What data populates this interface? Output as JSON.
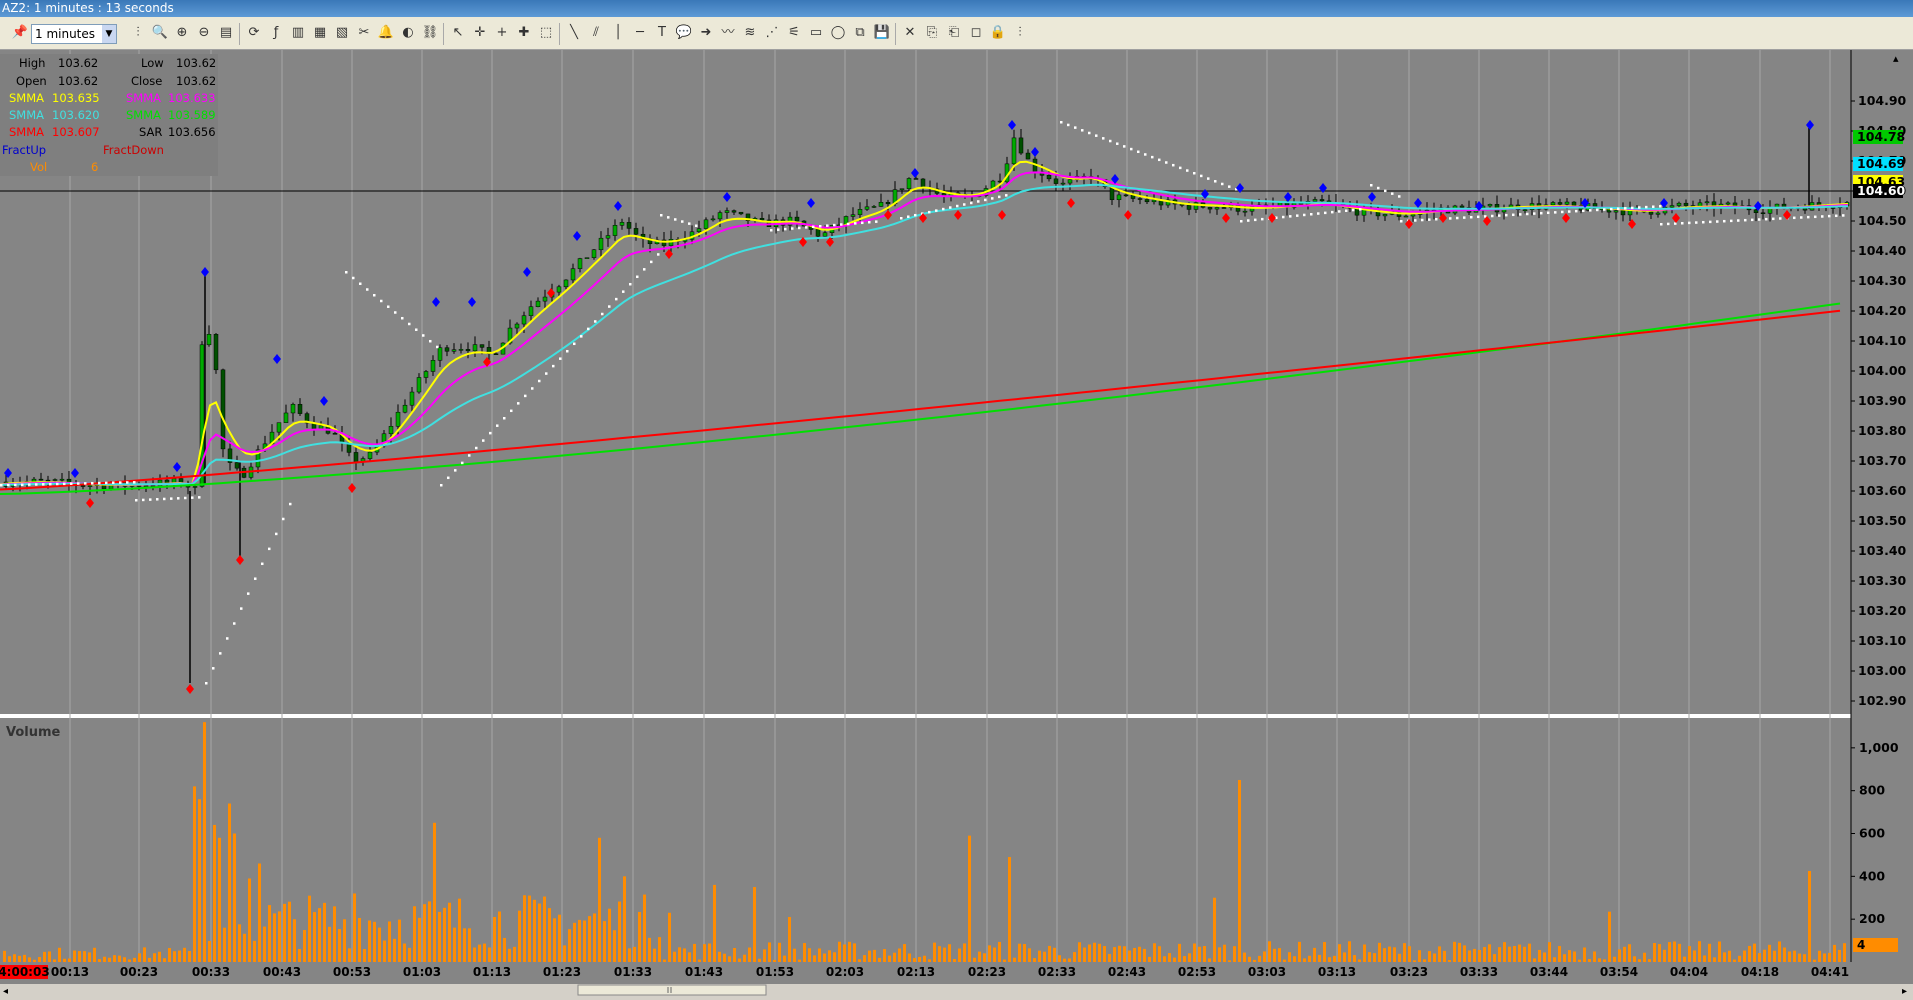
{
  "window": {
    "title": "AZ2: 1 minutes : 13 seconds"
  },
  "toolbar": {
    "interval": "1 minutes",
    "icons": [
      "pin-icon",
      "bar-style-icon",
      "zoom-icon",
      "zoom-in-icon",
      "zoom-out-icon",
      "properties-icon",
      "refresh-icon",
      "indicator-icon",
      "bars-icon",
      "colors-icon",
      "template-icon",
      "scissors-icon",
      "alert-icon",
      "globe-icon",
      "link-icon",
      "pointer-icon",
      "crosshair-icon",
      "cross-icon",
      "marker-icon",
      "select-icon",
      "line-icon",
      "parallel-icon",
      "vertical-line-icon",
      "horizontal-line-icon",
      "text-icon",
      "callout-icon",
      "arrow-icon",
      "wave-icon",
      "fib-icon",
      "pitchfork-icon",
      "gann-icon",
      "channel-icon",
      "rectangle-icon",
      "ellipse-icon",
      "layer-icon",
      "save-icon",
      "delete-icon",
      "copy-icon",
      "paste-icon",
      "frame-icon",
      "lock-icon"
    ]
  },
  "info": {
    "high_label": "High",
    "high": "103.62",
    "low_label": "Low",
    "low": "103.62",
    "open_label": "Open",
    "open": "103.62",
    "close_label": "Close",
    "close": "103.62",
    "smma_label": "SMMA",
    "sar_label": "SAR",
    "smma_yellow": "103.635",
    "smma_magenta": "103.633",
    "smma_cyan": "103.620",
    "smma_green": "103.589",
    "smma_red": "103.607",
    "sar": "103.656",
    "fract_up": "FractUp",
    "fract_down": "FractDown",
    "vol_label": "Vol",
    "vol": "6"
  },
  "chart_data": {
    "type": "candlestick",
    "price_axis": [
      "104.90",
      "104.80",
      "104.70",
      "104.60",
      "104.50",
      "104.40",
      "104.30",
      "104.20",
      "104.10",
      "104.00",
      "103.90",
      "103.80",
      "103.70",
      "103.60",
      "103.50",
      "103.40",
      "103.30",
      "103.20",
      "103.10",
      "103.00",
      "102.90"
    ],
    "price_range": [
      102.85,
      105.07
    ],
    "price_badges": [
      {
        "value": "104.78",
        "color": "#00c800",
        "text_color": "#000000"
      },
      {
        "value": "104.69",
        "color": "#00e0ff",
        "text_color": "#000000"
      },
      {
        "value": "104.63",
        "color": "#ffff00",
        "text_color": "#000000"
      },
      {
        "value": "104.60",
        "color": "#000000",
        "text_color": "#ffffff"
      }
    ],
    "last_price_line": 104.6,
    "time_axis": [
      "00:13",
      "00:23",
      "00:33",
      "00:43",
      "00:53",
      "01:03",
      "01:13",
      "01:23",
      "01:33",
      "01:43",
      "01:53",
      "02:03",
      "02:13",
      "02:23",
      "02:33",
      "02:43",
      "02:53",
      "03:03",
      "03:13",
      "03:23",
      "03:33",
      "03:44",
      "03:54",
      "04:04",
      "04:18",
      "04:41"
    ],
    "current_time": "4:00:03",
    "volume_label": "Volume",
    "volume_axis": [
      "1,000",
      "800",
      "600",
      "400",
      "200"
    ],
    "volume_range": [
      0,
      1130
    ],
    "volume_current": "4",
    "colors": {
      "up": "#00aa00",
      "down": "#005000",
      "yellow": "#ffff00",
      "magenta": "#ff00ff",
      "cyan": "#40e0e0",
      "red": "#ff0000",
      "green": "#00e000",
      "sar": "#ffffff",
      "fract_up": "#0000ff",
      "fract_down": "#ff0000",
      "volume": "#ff8c00"
    }
  }
}
